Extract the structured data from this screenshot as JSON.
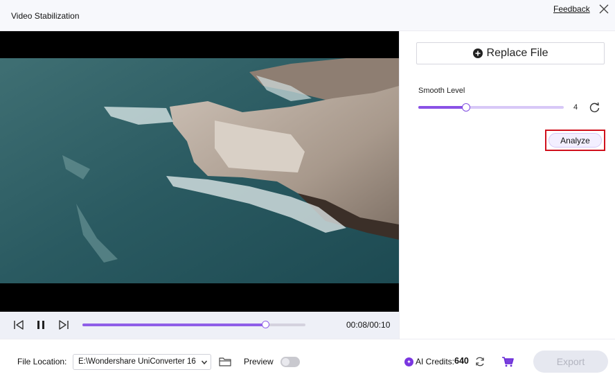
{
  "window": {
    "title": "Video Stabilization",
    "feedback_label": "Feedback",
    "close_icon": "close-icon"
  },
  "player": {
    "time": "00:08/00:10",
    "progress_percent": 82,
    "icons": [
      "skip-back-icon",
      "pause-icon",
      "skip-forward-icon"
    ],
    "accent_color": "#8f5ee8"
  },
  "panel": {
    "replace_label": "Replace File",
    "replace_icon": "plus-circle-icon",
    "smooth_label": "Smooth Level",
    "smooth_value": "4",
    "smooth_fraction": 0.33,
    "reset_icon": "reset-icon",
    "analyze_label": "Analyze",
    "highlight_color": "#d0101c"
  },
  "footer": {
    "file_location_label": "File Location:",
    "file_path": "E:\\Wondershare UniConverter 16",
    "preview_label": "Preview",
    "preview_on": false,
    "credits_label": "AI Credits:",
    "credits_value": "640",
    "export_label": "Export"
  }
}
